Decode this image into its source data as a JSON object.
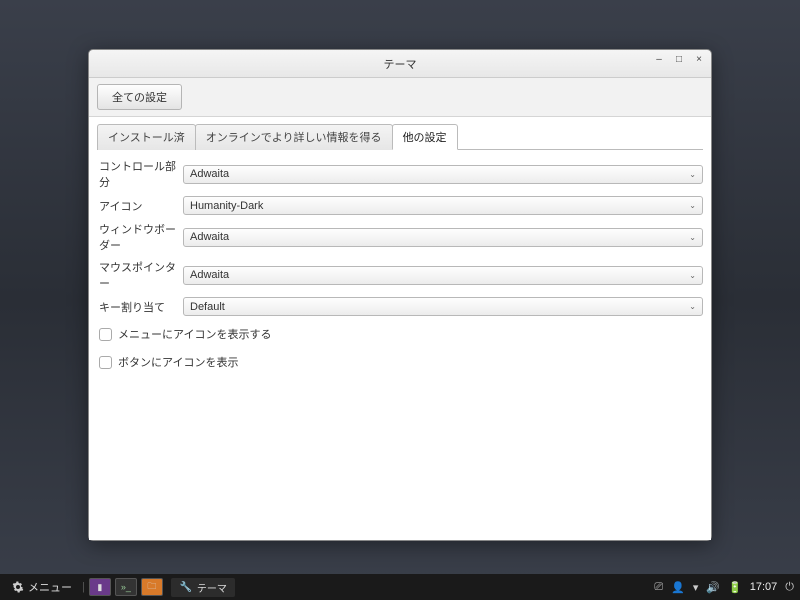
{
  "window": {
    "title": "テーマ",
    "toolbar": {
      "all_settings": "全ての設定"
    },
    "tabs": [
      {
        "label": "インストール済"
      },
      {
        "label": "オンラインでより詳しい情報を得る"
      },
      {
        "label": "他の設定"
      }
    ],
    "settings": {
      "controls_label": "コントロール部分",
      "controls_value": "Adwaita",
      "icons_label": "アイコン",
      "icons_value": "Humanity-Dark",
      "border_label": "ウィンドウボーダー",
      "border_value": "Adwaita",
      "pointer_label": "マウスポインター",
      "pointer_value": "Adwaita",
      "keybind_label": "キー割り当て",
      "keybind_value": "Default",
      "menu_icons_checkbox": "メニューにアイコンを表示する",
      "button_icons_checkbox": "ボタンにアイコンを表示"
    }
  },
  "taskbar": {
    "menu_label": "メニュー",
    "task_theme": "テーマ",
    "clock": "17:07"
  }
}
